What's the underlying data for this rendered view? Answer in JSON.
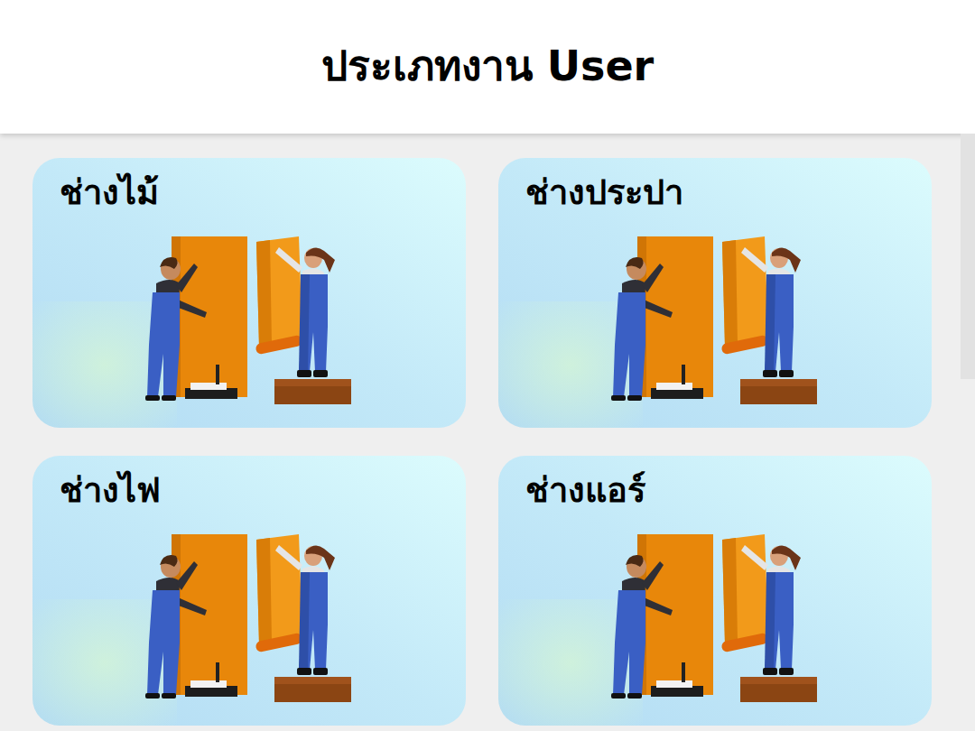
{
  "header": {
    "title": "ประเภทงาน User"
  },
  "categories": [
    {
      "label": "ช่างไม้"
    },
    {
      "label": "ช่างประปา"
    },
    {
      "label": "ช่างไฟ"
    },
    {
      "label": "ช่างแอร์"
    }
  ]
}
